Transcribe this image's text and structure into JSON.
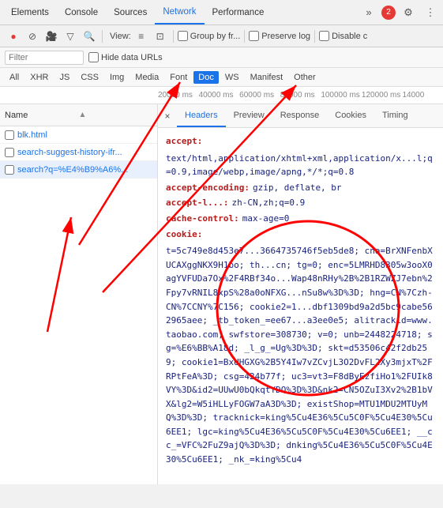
{
  "topTabs": {
    "items": [
      {
        "label": "Elements",
        "active": false
      },
      {
        "label": "Console",
        "active": false
      },
      {
        "label": "Sources",
        "active": false
      },
      {
        "label": "Network",
        "active": true
      },
      {
        "label": "Performance",
        "active": false
      }
    ],
    "overflow": "»",
    "errorBadge": "2",
    "settingsIcon": "⚙",
    "moreIcon": "⋮"
  },
  "toolbar": {
    "recordIcon": "●",
    "stopIcon": "⊘",
    "cameraIcon": "📷",
    "filterIcon": "▽",
    "searchIcon": "🔍",
    "viewLabel": "View:",
    "listIcon": "≡",
    "detailIcon": "⊡",
    "groupByLabel": "Group by fr...",
    "preserveLabel": "Preserve log",
    "disableLabel": "Disable c"
  },
  "filterBar": {
    "placeholder": "Filter",
    "hideDataUrlsLabel": "Hide data URLs"
  },
  "filterTypes": {
    "items": [
      "All",
      "XHR",
      "JS",
      "CSS",
      "Img",
      "Media",
      "Font",
      "Doc",
      "WS",
      "Manifest",
      "Other"
    ],
    "active": "Doc"
  },
  "timeline": {
    "labels": [
      "20000 ms",
      "40000 ms",
      "60000 ms",
      "80000 ms",
      "100000 ms",
      "120000 ms",
      "14000"
    ]
  },
  "fileList": {
    "header": "Name",
    "items": [
      {
        "name": "blk.html",
        "selected": false
      },
      {
        "name": "search-suggest-history-ifr...",
        "selected": false
      },
      {
        "name": "search?q=%E4%B9%A6%...",
        "selected": true
      }
    ]
  },
  "detailPanel": {
    "closeLabel": "×",
    "tabs": [
      {
        "label": "Headers",
        "active": true
      },
      {
        "label": "Preview",
        "active": false
      },
      {
        "label": "Response",
        "active": false
      },
      {
        "label": "Cookies",
        "active": false
      },
      {
        "label": "Timing",
        "active": false
      }
    ],
    "headers": [
      {
        "name": "accept:",
        "value": "text/html,application/xhtml+xml,application/x...l;q=0.9,image/webp,image/apng,*/*;q=0.8"
      },
      {
        "name": "accept-encoding:",
        "value": "gzip, deflate, br"
      },
      {
        "name": "accept-l...",
        "value": "zh-CN,zh;q=0.9"
      },
      {
        "name": "cache-control:",
        "value": "max-age=0"
      },
      {
        "name": "cookie:",
        "value": "t=5c749e8d453e7...3664735746f5eb5de8; cna=BrXNFenbXUCAXggNKX9H1bo; th...cn; tg=0; enc=5LMRHD8305w3ooX0agYVFUDa7Ox%2F4RBf34o...Wap48nRHy%2B%2B1RZWZJ7ebn%2Fpy7vRNIL8xpS%28a0oNFXG...nSu8w%3D%3D; hng=CN%7Czh-CN%7CCNY%7C156; cookie2=1...dbf1309bd9a2d5bc9cabe562965aee; _tb_token_=ee67...a3ee0e5; alitrackid=www.taobao.com; swfstore=308730; v=0; unb=2448224718; sg=%E6%BB%A18d; _l_g_=Ug%3D%3D; skt=d53506c42f2db259; cookie1=BxUHGXG%2B5Y4Iw7vZCvjL3O2DvFL2Xy3mjxT%2FRPtFeA%3D; csg=424b77f; uc3=vt3=F8dByEzfiHo1%2FUIk8VY%3D&id2=UUwU0bQkqtYDQ%3D%3D&nk2=CN5OZuI3Xv2%2B1bVX&lg2=W5iHLLyFOGW7aA3D%3D; existShop=MTU1MDU2MTUyMQ%3D%3D; tracknick=king%5Cu4E36%5Cu5C0F%5Cu4E30%5Cu6EE1; lgc=king%5Cu4E36%5Cu5C0F%5Cu4E30%5Cu6EE1; __cc_=VFC%2FuZ9ajQ%3D%3D; dnking%5Cu4E36%5Cu5C0F%5Cu4E30%5Cu6EE1; _nk_=king%5Cu4"
      }
    ]
  },
  "annotations": {
    "arrow1": "Font tab arrow",
    "arrow2": "Other tab arrow",
    "arrow3": "file item arrow",
    "circle": "cookie value highlight"
  }
}
